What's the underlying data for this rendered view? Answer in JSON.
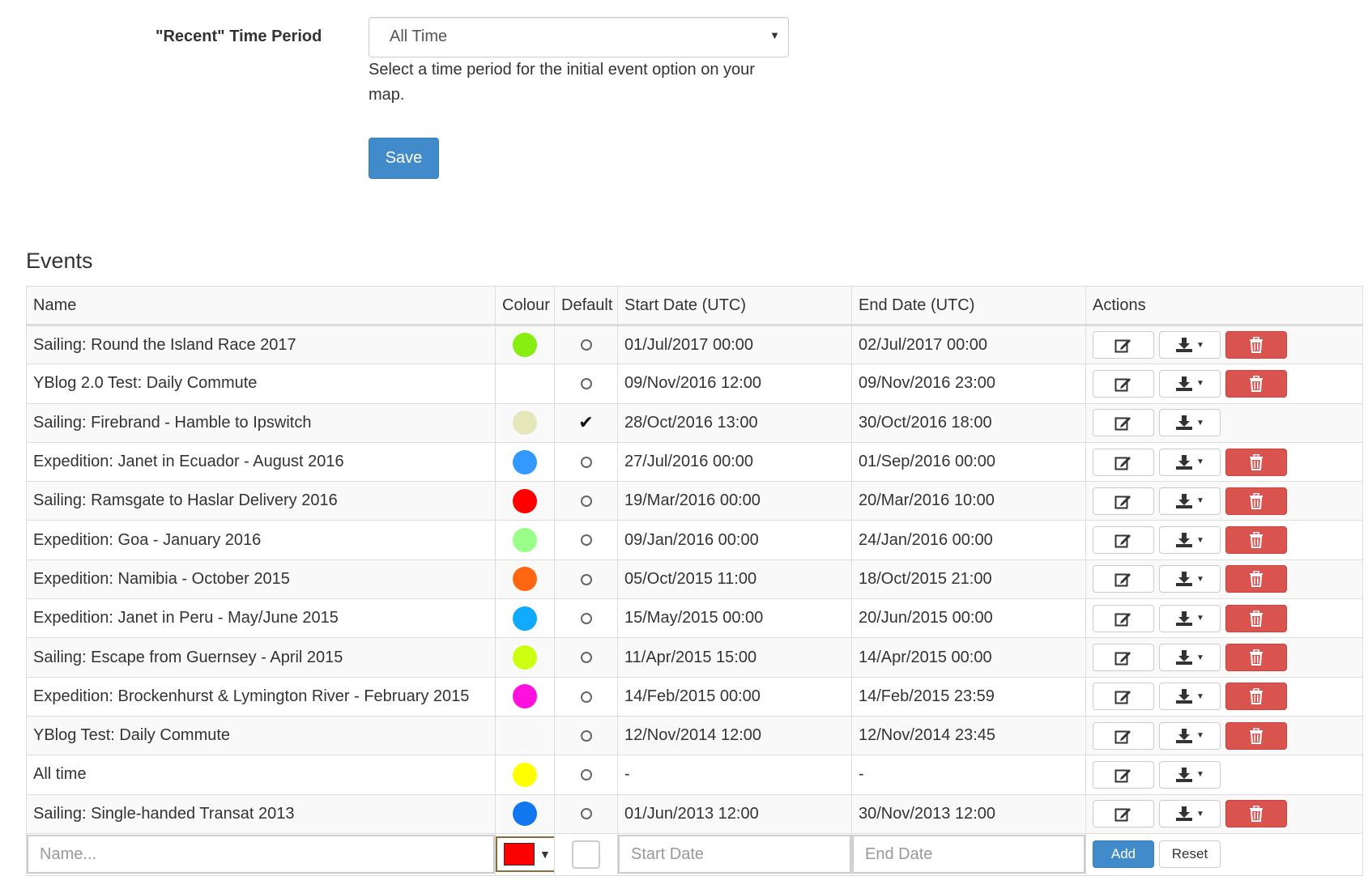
{
  "form": {
    "label": "\"Recent\" Time Period",
    "select_value": "All Time",
    "help_text": "Select a time period for the initial event option on your map.",
    "save_label": "Save"
  },
  "events": {
    "title": "Events",
    "headers": {
      "name": "Name",
      "colour": "Colour",
      "default": "Default",
      "start": "Start Date (UTC)",
      "end": "End Date (UTC)",
      "actions": "Actions"
    },
    "rows": [
      {
        "name": "Sailing: Round the Island Race 2017",
        "colour": "#88ee11",
        "default": false,
        "start": "01/Jul/2017 00:00",
        "end": "02/Jul/2017 00:00",
        "deletable": true
      },
      {
        "name": "YBlog 2.0 Test: Daily Commute",
        "colour": "",
        "default": false,
        "start": "09/Nov/2016 12:00",
        "end": "09/Nov/2016 23:00",
        "deletable": true
      },
      {
        "name": "Sailing: Firebrand - Hamble to Ipswitch",
        "colour": "#e6e6bb",
        "default": true,
        "start": "28/Oct/2016 13:00",
        "end": "30/Oct/2016 18:00",
        "deletable": false
      },
      {
        "name": "Expedition: Janet in Ecuador - August 2016",
        "colour": "#3399ff",
        "default": false,
        "start": "27/Jul/2016 00:00",
        "end": "01/Sep/2016 00:00",
        "deletable": true
      },
      {
        "name": "Sailing: Ramsgate to Haslar Delivery 2016",
        "colour": "#ff0000",
        "default": false,
        "start": "19/Mar/2016 00:00",
        "end": "20/Mar/2016 10:00",
        "deletable": true
      },
      {
        "name": "Expedition: Goa - January 2016",
        "colour": "#99ff88",
        "default": false,
        "start": "09/Jan/2016 00:00",
        "end": "24/Jan/2016 00:00",
        "deletable": true
      },
      {
        "name": "Expedition: Namibia - October 2015",
        "colour": "#ff6611",
        "default": false,
        "start": "05/Oct/2015 11:00",
        "end": "18/Oct/2015 21:00",
        "deletable": true
      },
      {
        "name": "Expedition: Janet in Peru - May/June 2015",
        "colour": "#11aaff",
        "default": false,
        "start": "15/May/2015 00:00",
        "end": "20/Jun/2015 00:00",
        "deletable": true
      },
      {
        "name": "Sailing: Escape from Guernsey - April 2015",
        "colour": "#ccff11",
        "default": false,
        "start": "11/Apr/2015 15:00",
        "end": "14/Apr/2015 00:00",
        "deletable": true
      },
      {
        "name": "Expedition: Brockenhurst & Lymington River - February 2015",
        "colour": "#ff11dd",
        "default": false,
        "start": "14/Feb/2015 00:00",
        "end": "14/Feb/2015 23:59",
        "deletable": true
      },
      {
        "name": "YBlog Test: Daily Commute",
        "colour": "#f8f8f8",
        "default": false,
        "start": "12/Nov/2014 12:00",
        "end": "12/Nov/2014 23:45",
        "deletable": true
      },
      {
        "name": "All time",
        "colour": "#ffff00",
        "default": false,
        "start": "-",
        "end": "-",
        "deletable": false
      },
      {
        "name": "Sailing: Single-handed Transat 2013",
        "colour": "#1177ee",
        "default": false,
        "start": "01/Jun/2013 12:00",
        "end": "30/Nov/2013 12:00",
        "deletable": true
      }
    ],
    "add_row": {
      "name_placeholder": "Name...",
      "colour": "#ff0000",
      "start_placeholder": "Start Date",
      "end_placeholder": "End Date",
      "add_label": "Add",
      "reset_label": "Reset"
    }
  },
  "icons": {
    "edit": "edit-icon",
    "download": "download-icon",
    "delete": "trash-icon"
  }
}
